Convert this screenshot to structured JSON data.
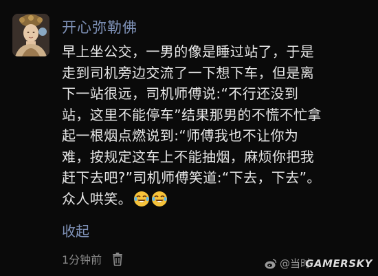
{
  "post": {
    "username": "开心弥勒佛",
    "content_lines": [
      "早上坐公交，一男的像是睡过站了，于是",
      "走到司机旁边交流了一下想下车，但是离",
      "下一站很远，司机师傅说:“不行还没到",
      "站，这里不能停车”结果那男的不慌不忙拿",
      "起一根烟点燃说到:“师傅我也不让你为",
      "难，按规定这车上不能抽烟，麻烦你把我",
      "赶下去吧?”司机师傅笑道:“下去，下去”。",
      "众人哄笑。"
    ],
    "emojis": [
      "laughing-crying-emoji",
      "laughing-crying-emoji"
    ],
    "collapse_label": "收起",
    "timestamp": "1分钟前",
    "delete_icon": "trash-icon"
  },
  "watermark": {
    "source_icon": "weibo-icon",
    "prefix": "@当时",
    "brand": "GAMERSKY"
  },
  "colors": {
    "background": "#0a0a0a",
    "username": "#7f92b8",
    "text": "#e6e6e6",
    "meta": "#8a8a8a"
  }
}
